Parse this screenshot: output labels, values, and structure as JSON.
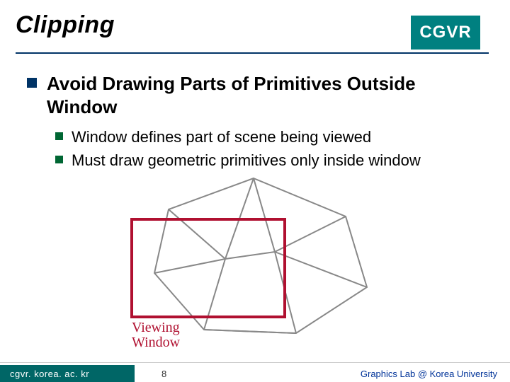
{
  "header": {
    "title": "Clipping",
    "badge": "CGVR"
  },
  "bullets": {
    "lvl1": "Avoid Drawing Parts of Primitives Outside Window",
    "lvl2a": "Window defines part of scene being viewed",
    "lvl2b": "Must draw geometric primitives only inside window"
  },
  "figure": {
    "caption_l1": "Viewing",
    "caption_l2": "Window"
  },
  "footer": {
    "left": "cgvr. korea. ac. kr",
    "page": "8",
    "right": "Graphics Lab @ Korea University"
  }
}
